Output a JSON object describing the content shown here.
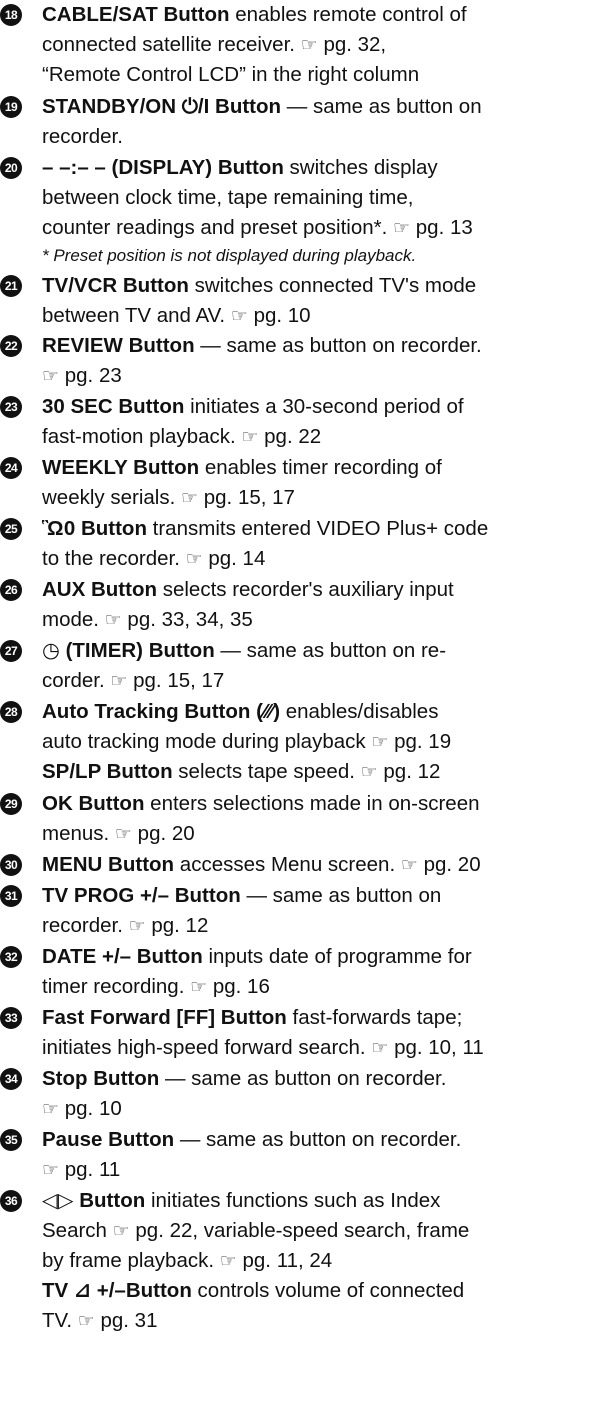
{
  "pgref_icon": "pointing-hand-icon",
  "items": [
    {
      "num": "18",
      "title": "CABLE/SAT Button",
      "t1": " enables remote control of",
      "l2": "connected satellite receiver. ",
      "ref": "pg. 32,",
      "l3": "“Remote Control LCD” in the right column"
    },
    {
      "num": "19",
      "title": "STANDBY/ON ⏻/I Button",
      "t1": " — same as button on",
      "l2": "recorder."
    },
    {
      "num": "20",
      "title": "– –:– – (DISPLAY) Button",
      "t1": " switches display",
      "l2": "between clock time, tape remaining time,",
      "l3a": "counter readings and preset position*.",
      "ref": "pg. 13",
      "note": "* Preset position is not displayed during playback."
    },
    {
      "num": "21",
      "title": "TV/VCR Button",
      "t1": " switches connected TV's mode",
      "l2": "between TV and AV. ",
      "ref": "pg. 10"
    },
    {
      "num": "22",
      "title": "REVIEW Button",
      "t1": " — same as button on recorder.",
      "ref": "pg. 23"
    },
    {
      "num": "23",
      "title": "30 SEC Button",
      "t1": " initiates a 30-second period of",
      "l2": "fast-motion playback. ",
      "ref": "pg. 22"
    },
    {
      "num": "24",
      "title": "WEEKLY Button",
      "t1": " enables timer recording of",
      "l2": "weekly serials. ",
      "ref": "pg. 15, 17"
    },
    {
      "num": "25",
      "title": "Ὣ0 Button",
      "t1": " transmits entered VIDEO Plus+ code",
      "l2": "to the recorder. ",
      "ref": "pg. 14"
    },
    {
      "num": "26",
      "title": "AUX Button",
      "t1": " selects recorder's auxiliary input",
      "l2": "mode. ",
      "ref": "pg. 33, 34, 35"
    },
    {
      "num": "27",
      "title": "◷ (TIMER) Button",
      "t1": " — same as button on re-",
      "l2": "corder. ",
      "ref": "pg. 15, 17"
    },
    {
      "num": "28",
      "title": "Auto Tracking Button (∕∕∕)",
      "t1": " enables/disables",
      "l2": "auto tracking mode during playback ",
      "ref": "pg. 19",
      "sub_title": "SP/LP Button",
      "sub_text": " selects tape speed. ",
      "sub_ref": "pg. 12"
    },
    {
      "num": "29",
      "title": "OK Button",
      "t1": " enters selections made in on-screen",
      "l2": "menus. ",
      "ref": "pg. 20"
    },
    {
      "num": "30",
      "title": "MENU Button",
      "t1": " accesses Menu screen. ",
      "ref": "pg. 20"
    },
    {
      "num": "31",
      "title": "TV PROG +/– Button",
      "t1": " — same as button on",
      "l2": "recorder. ",
      "ref": "pg. 12"
    },
    {
      "num": "32",
      "title": "DATE +/– Button",
      "t1": " inputs date of programme for",
      "l2": "timer recording. ",
      "ref": "pg. 16"
    },
    {
      "num": "33",
      "title": "Fast Forward [FF] Button",
      "t1": " fast-forwards tape;",
      "l2": "initiates high-speed forward search. ",
      "ref": "pg. 10, 11"
    },
    {
      "num": "34",
      "title": "Stop Button",
      "t1": " — same as button on recorder.",
      "ref": "pg. 10"
    },
    {
      "num": "35",
      "title": "Pause Button",
      "t1": " — same as button on recorder.",
      "ref": "pg. 11"
    },
    {
      "num": "36",
      "title": "◁▷ Button",
      "t1": " initiates functions such as Index",
      "l2a": "Search ",
      "ref_a": "pg. 22,",
      "l2b": " variable-speed search, frame",
      "l3": "by frame playback. ",
      "ref": "pg. 11, 24",
      "sub_title": "TV ⊿ +/–Button",
      "sub_text": " controls volume of connected",
      "sub_l2": "TV. ",
      "sub_ref": "pg. 31"
    }
  ]
}
